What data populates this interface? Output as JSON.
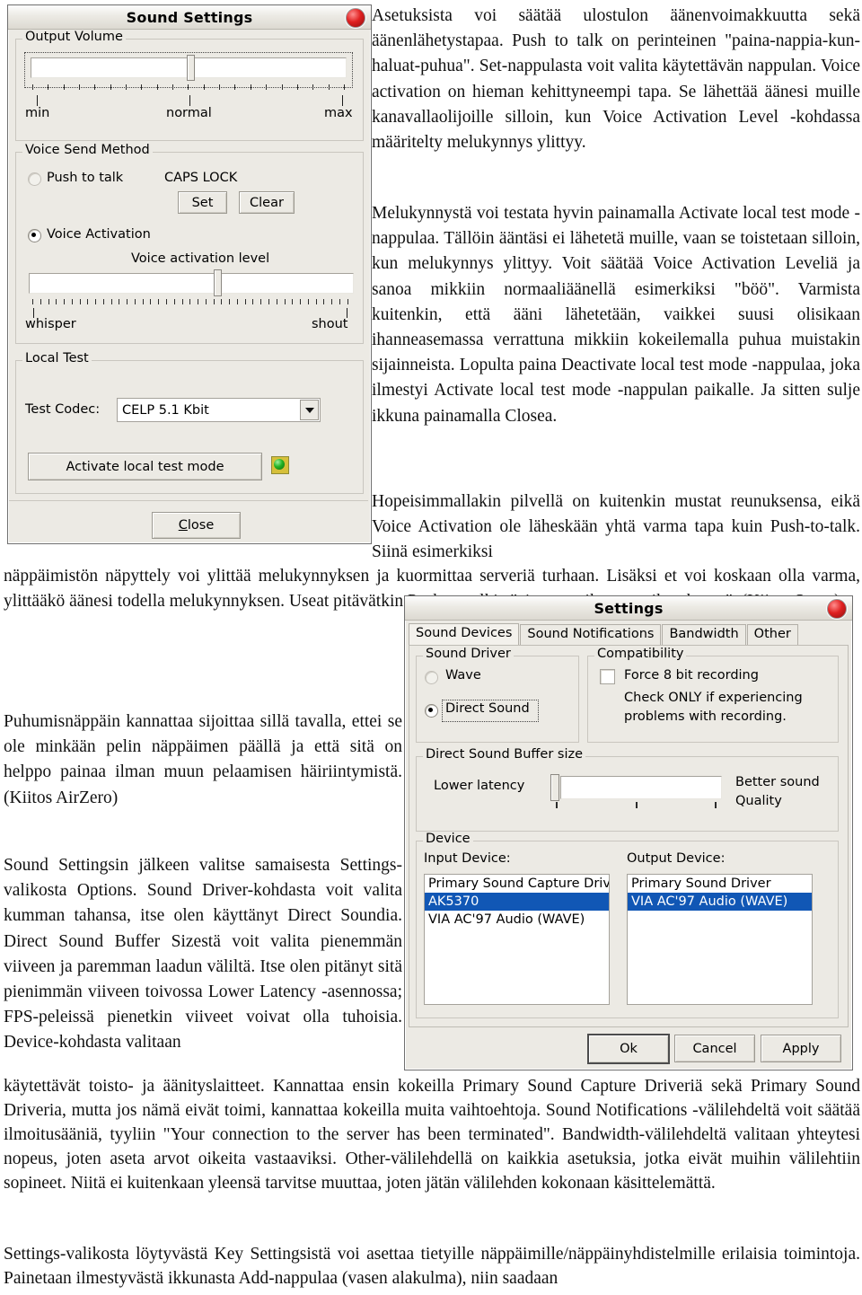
{
  "document": {
    "paragraphs": {
      "p_top": "Asetuksista voi säätää ulostulon äänenvoimakkuutta sekä äänenlähetystapaa. Push to talk on perinteinen \"paina-nappia-kun-haluat-puhua\". Set-nappulasta voit valita käytettävän nappulan. Voice activation on hieman kehittyneempi tapa. Se lähettää äänesi muille kanavallaolijoille silloin, kun Voice Activation Level -kohdassa määritelty melukynnys ylittyy.",
      "p_mid": "Melukynnystä voi testata hyvin painamalla Activate local test mode -nappulaa. Tällöin ääntäsi ei lähetetä muille, vaan se toistetaan silloin, kun melukynnys ylittyy. Voit säätää Voice Activation Leveliä ja sanoa mikkiin normaaliäänellä esimerkiksi \"böö\". Varmista kuitenkin, että ääni lähetetään, vaikkei suusi olisikaan ihanneasemassa verrattuna mikkiin kokeilemalla puhua muistakin sijainneista. Lopulta paina Deactivate local test mode -nappulaa, joka ilmestyi Activate local test mode -nappulan paikalle. Ja sitten sulje ikkuna painamalla Closea.",
      "p_hope": "Hopeisimmallakin pilvellä on kuitenkin mustat reunuksensa, eikä Voice Activation ole läheskään yhtä varma tapa kuin Push-to-talk. Siinä esimerkiksi",
      "p_flow1": "näppäimistön näpyttely voi ylittää melukynnyksen ja kuormittaa serveriä turhaan. Lisäksi et voi koskaan olla varma, ylittääkö äänesi todella melukynnyksen. Useat pitävätkin Push-to-talkia \"ainoana oikeana vaihtoehtona\". (Kiitos Stany)",
      "p_left1": "Puhumisnäppäin kannattaa sijoittaa sillä tavalla, ettei se ole minkään pelin näppäimen päällä ja että sitä on helppo painaa ilman muun pelaamisen häiriintymistä. (Kiitos AirZero)",
      "p_left2": "Sound Settingsin jälkeen valitse samaisesta Settings-valikosta Options. Sound Driver-kohdasta voit valita kumman tahansa, itse olen käyttänyt Direct Soundia. Direct Sound Buffer Sizestä voit valita pienemmän viiveen ja paremman laadun väliltä. Itse olen pitänyt sitä pienimmän viiveen toivossa Lower Latency -asennossa; FPS-peleissä pienetkin viiveet voivat olla tuhoisia. Device-kohdasta valitaan",
      "p_flow2": "käytettävät toisto- ja äänityslaitteet. Kannattaa ensin kokeilla Primary Sound Capture Driveriä sekä Primary Sound Driveria, mutta jos nämä eivät toimi, kannattaa kokeilla muita vaihtoehtoja. Sound Notifications -välilehdeltä voit säätää ilmoitusääniä, tyyliin \"Your connection to the server has been terminated\". Bandwidth-välilehdeltä valitaan yhteytesi nopeus, joten aseta arvot oikeita vastaaviksi. Other-välilehdellä on kaikkia asetuksia, jotka eivät muihin välilehtiin sopineet. Niitä ei kuitenkaan yleensä tarvitse muuttaa, joten jätän välilehden kokonaan käsittelemättä.",
      "p_flow3": "Settings-valikosta löytyvästä Key Settingsistä voi asettaa tietyille näppäimille/näppäinyhdistelmille erilaisia toimintoja. Painetaan ilmestyvästä ikkunasta Add-nappulaa (vasen alakulma), niin saadaan"
    }
  },
  "sound_settings_dialog": {
    "title": "Sound Settings",
    "close_icon": "window-close-icon",
    "output_volume": {
      "group_label": "Output Volume",
      "min_label": "min",
      "normal_label": "normal",
      "max_label": "max",
      "value_percent": 50
    },
    "voice_send_method": {
      "group_label": "Voice Send Method",
      "push_to_talk_label": "Push to talk",
      "push_to_talk_selected": false,
      "hotkey_value": "CAPS LOCK",
      "set_button": "Set",
      "clear_button": "Clear",
      "voice_activation_label": "Voice Activation",
      "voice_activation_selected": true,
      "level_label": "Voice activation level",
      "whisper_label": "whisper",
      "shout_label": "shout",
      "level_percent": 58
    },
    "local_test": {
      "group_label": "Local Test",
      "codec_label": "Test Codec:",
      "codec_value": "CELP 5.1 Kbit",
      "activate_button": "Activate local test mode",
      "led_icon": "green-led-indicator"
    },
    "close_button": "Close"
  },
  "settings_dialog": {
    "title": "Settings",
    "close_icon": "window-close-icon",
    "tabs": [
      {
        "label": "Sound Devices",
        "active": true
      },
      {
        "label": "Sound Notifications",
        "active": false
      },
      {
        "label": "Bandwidth",
        "active": false
      },
      {
        "label": "Other",
        "active": false
      }
    ],
    "sound_driver": {
      "group_label": "Sound Driver",
      "wave_label": "Wave",
      "wave_selected": false,
      "direct_sound_label": "Direct Sound",
      "direct_sound_selected": true
    },
    "compatibility": {
      "group_label": "Compatibility",
      "force8bit_label": "Force 8 bit recording",
      "force8bit_checked": false,
      "hint_line1": "Check ONLY if experiencing",
      "hint_line2": "problems with recording."
    },
    "buffer": {
      "group_label": "Direct Sound Buffer size",
      "left_label": "Lower latency",
      "right_label_line1": "Better sound",
      "right_label_line2": "Quality",
      "value_percent": 0
    },
    "device": {
      "group_label": "Device",
      "input_label": "Input Device:",
      "output_label": "Output Device:",
      "input_items": [
        {
          "label": "Primary Sound Capture Driv",
          "selected": false
        },
        {
          "label": "AK5370",
          "selected": true
        },
        {
          "label": "VIA AC'97 Audio (WAVE)",
          "selected": false
        }
      ],
      "output_items": [
        {
          "label": "Primary Sound Driver",
          "selected": false
        },
        {
          "label": "VIA AC'97 Audio (WAVE)",
          "selected": true
        }
      ]
    },
    "buttons": {
      "ok": "Ok",
      "cancel": "Cancel",
      "apply": "Apply"
    }
  },
  "colors": {
    "selection_blue": "#1157b5",
    "dialog_face": "#eceae4",
    "close_red": "#e02020",
    "led_green": "#24b324"
  }
}
